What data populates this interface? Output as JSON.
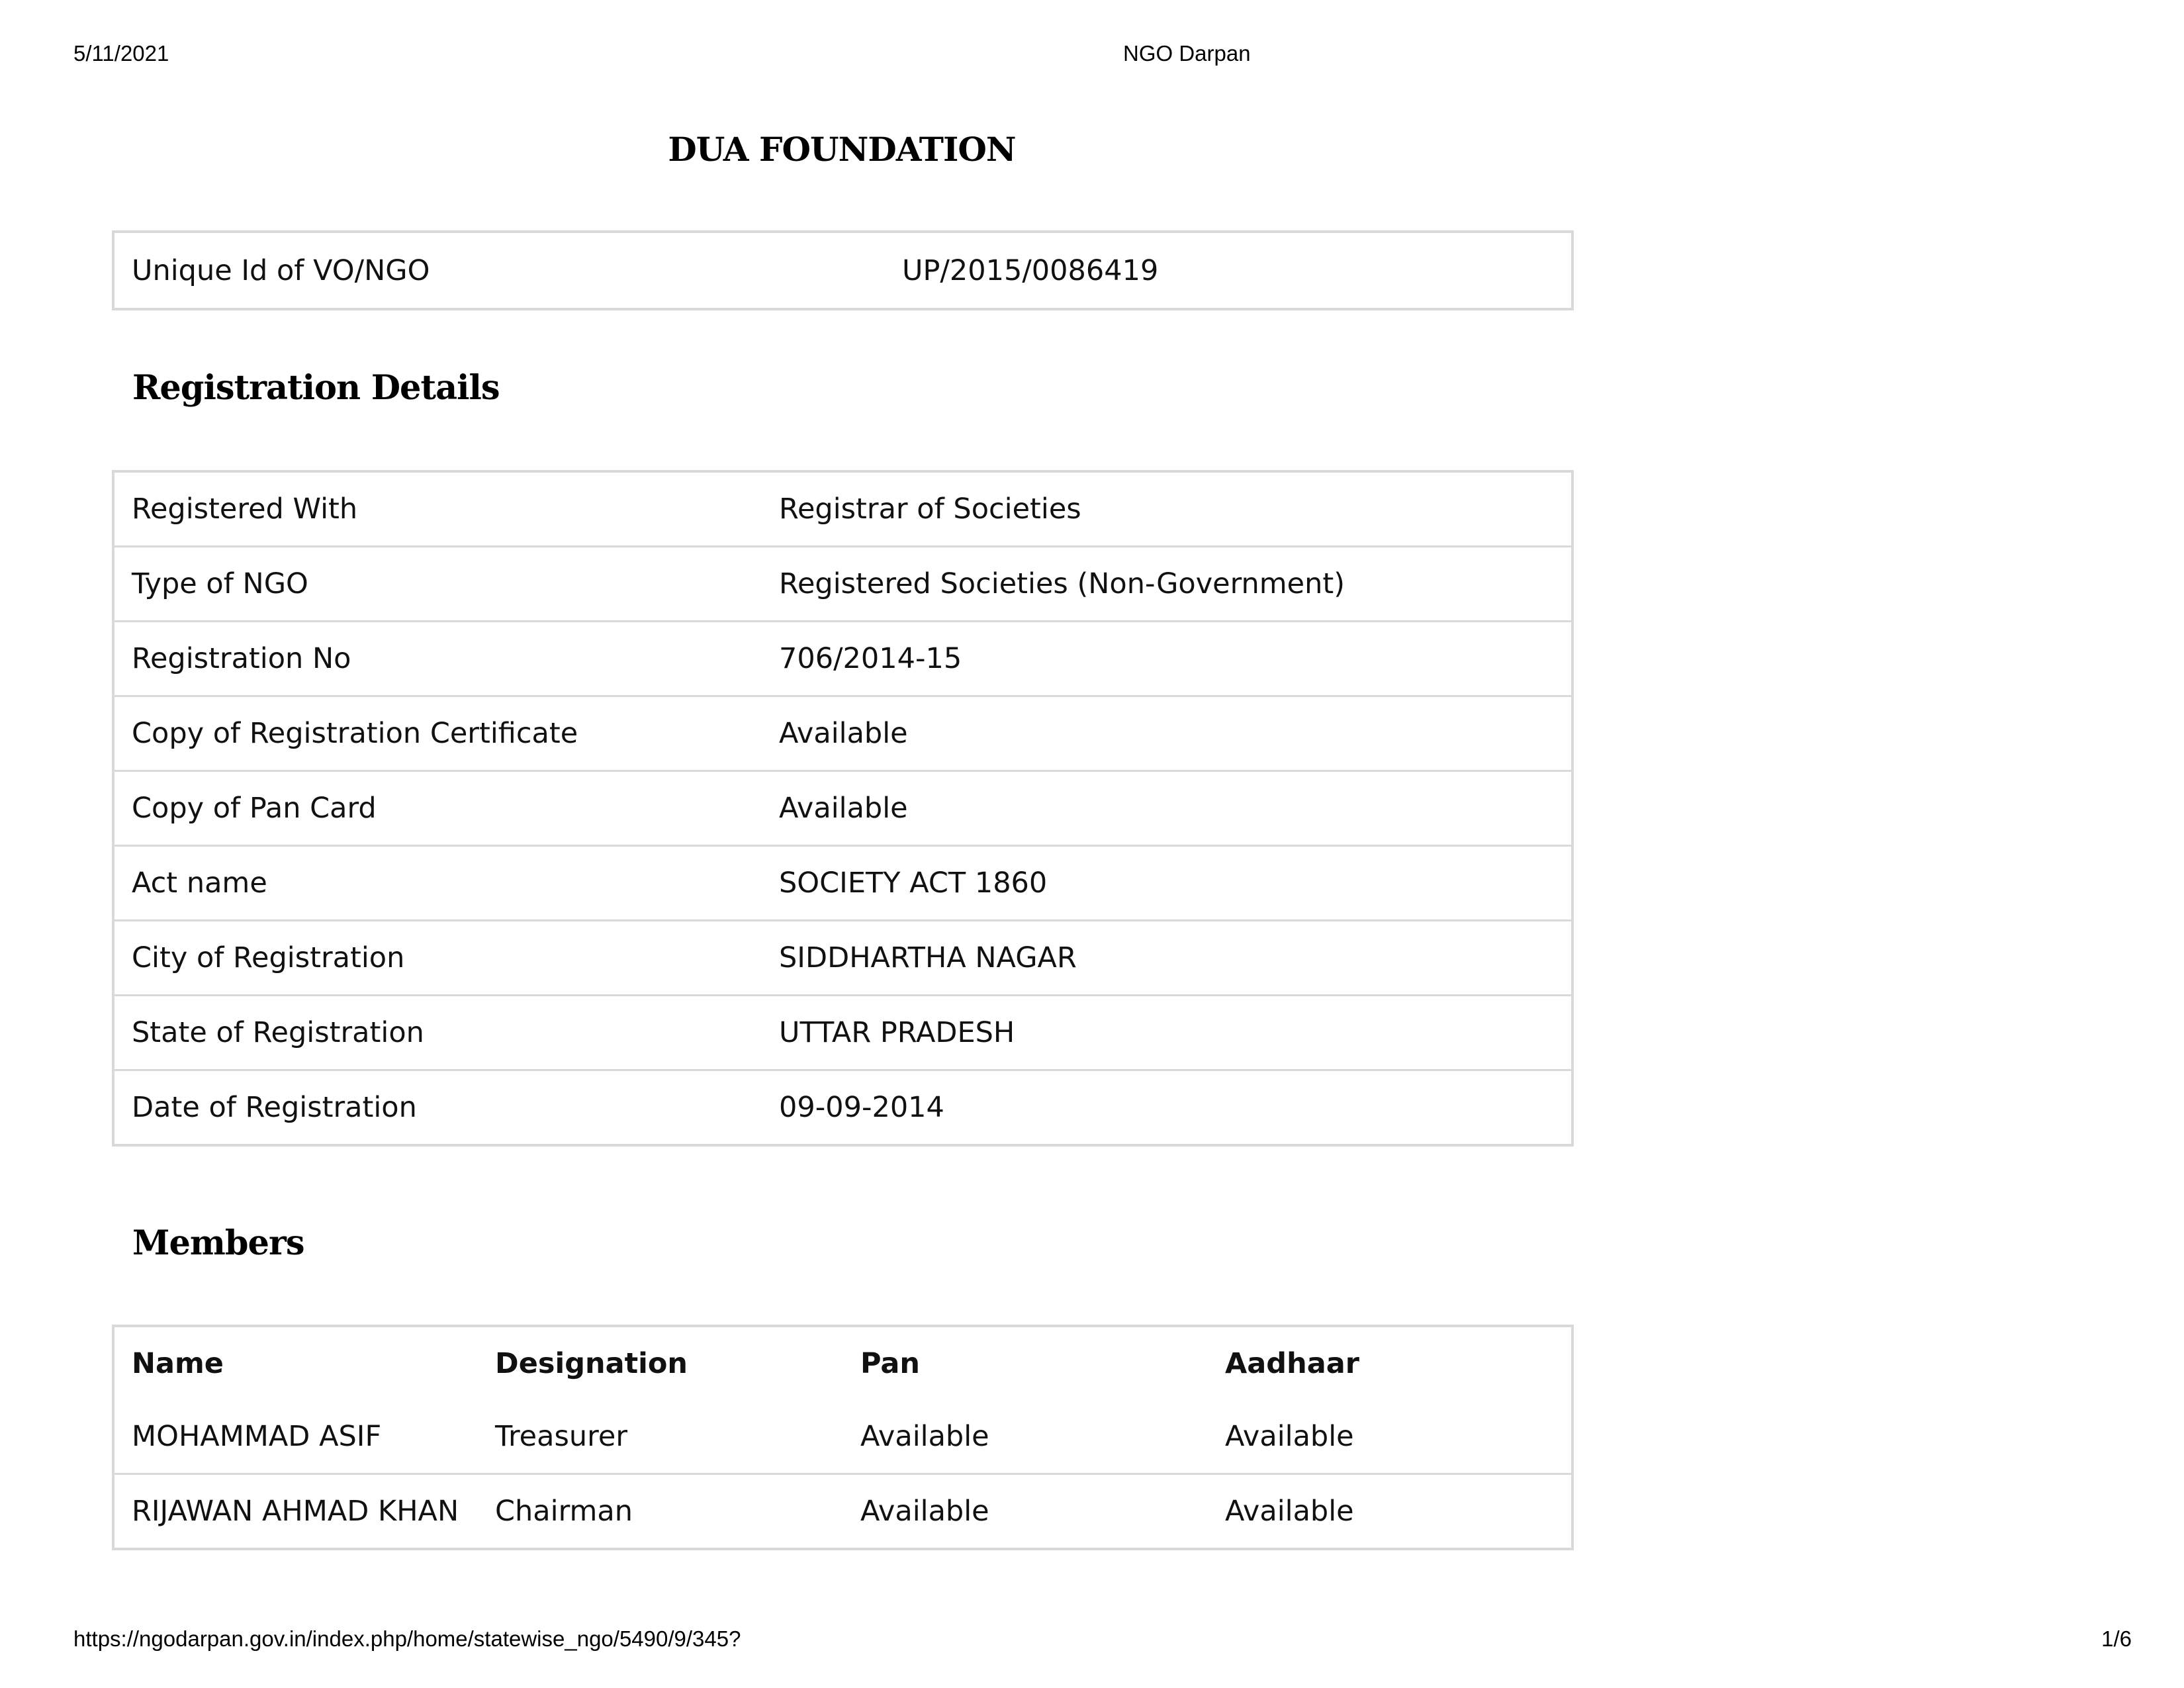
{
  "print_header": {
    "date": "5/11/2021",
    "site_title": "NGO Darpan"
  },
  "print_footer": {
    "url": "https://ngodarpan.gov.in/index.php/home/statewise_ngo/5490/9/345?",
    "page": "1/6"
  },
  "organization": {
    "name": "DUA FOUNDATION"
  },
  "unique_id": {
    "label": "Unique Id of VO/NGO",
    "value": "UP/2015/0086419"
  },
  "registration": {
    "heading": "Registration Details",
    "rows": [
      {
        "label": "Registered With",
        "value": "Registrar of Societies"
      },
      {
        "label": "Type of NGO",
        "value": "Registered Societies (Non-Government)"
      },
      {
        "label": "Registration No",
        "value": "706/2014-15"
      },
      {
        "label": "Copy of Registration Certificate",
        "value": "Available"
      },
      {
        "label": "Copy of Pan Card",
        "value": "Available"
      },
      {
        "label": "Act name",
        "value": "SOCIETY ACT 1860"
      },
      {
        "label": "City of Registration",
        "value": "SIDDHARTHA NAGAR"
      },
      {
        "label": "State of Registration",
        "value": "UTTAR PRADESH"
      },
      {
        "label": "Date of Registration",
        "value": "09-09-2014"
      }
    ]
  },
  "members": {
    "heading": "Members",
    "columns": [
      "Name",
      "Designation",
      "Pan",
      "Aadhaar"
    ],
    "rows": [
      {
        "name": "MOHAMMAD ASIF",
        "designation": "Treasurer",
        "pan": "Available",
        "aadhaar": "Available"
      },
      {
        "name": "RIJAWAN AHMAD KHAN",
        "designation": "Chairman",
        "pan": "Available",
        "aadhaar": "Available"
      }
    ]
  }
}
